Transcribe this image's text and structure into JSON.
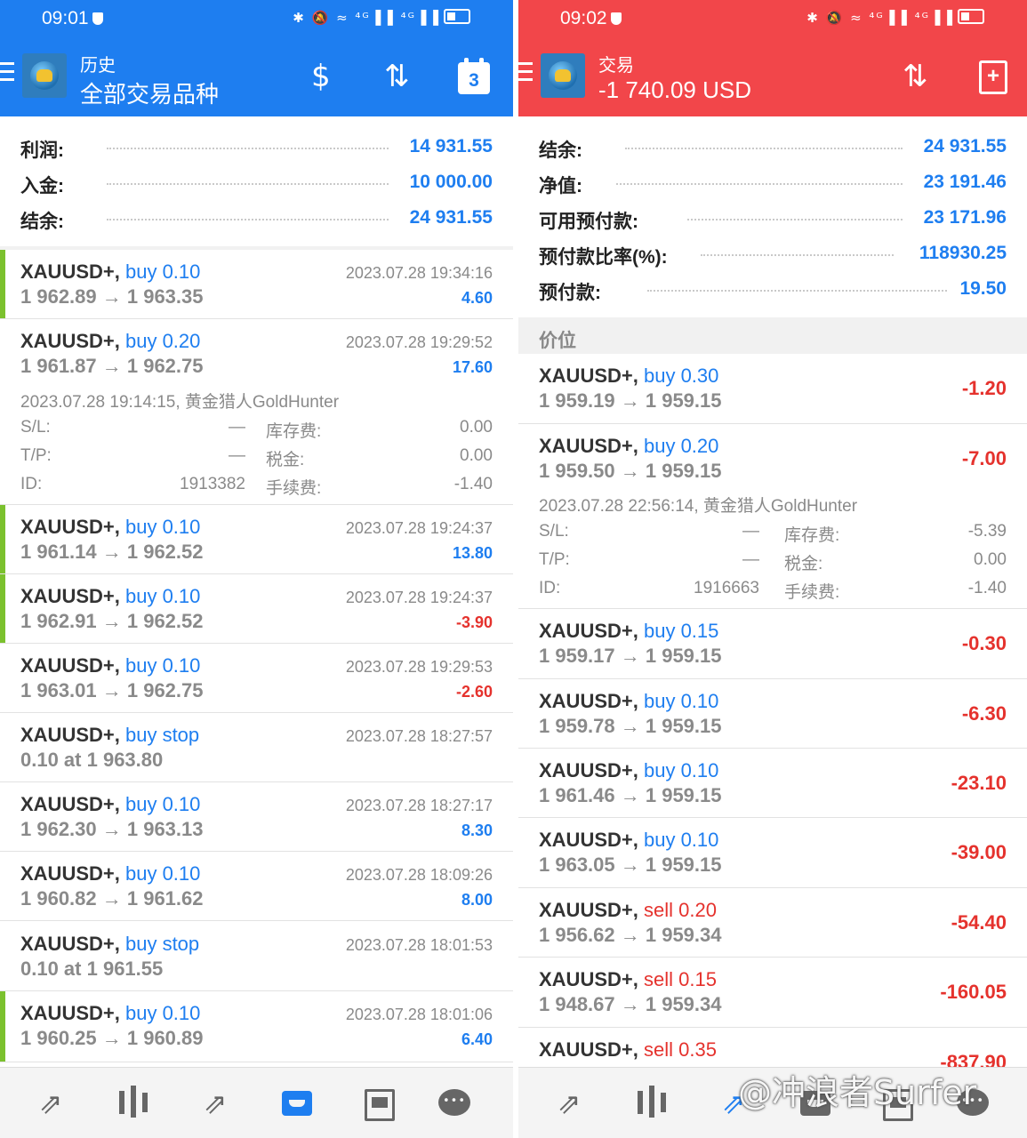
{
  "left": {
    "status": {
      "time": "09:01",
      "icons": "✱ 🔕 ≈ ⁴ᴳ▐▐ ⁴ᴳ▐▐"
    },
    "header": {
      "subtitle": "历史",
      "title": "全部交易品种",
      "icons": [
        "dollar-refresh-icon",
        "sort-icon",
        "calendar-icon"
      ],
      "calendar_day": "3"
    },
    "summary": [
      {
        "label": "利润:",
        "value": "14 931.55"
      },
      {
        "label": "入金:",
        "value": "10 000.00"
      },
      {
        "label": "结余:",
        "value": "24 931.55"
      }
    ],
    "trades": [
      {
        "symbol": "XAUUSD+,",
        "side": "buy 0.10",
        "prices": "1 962.89 → 1 963.35",
        "time": "2023.07.28 19:34:16",
        "profit": "4.60"
      },
      {
        "symbol": "XAUUSD+,",
        "side": "buy 0.20",
        "prices": "1 961.87 → 1 962.75",
        "time": "2023.07.28 19:29:52",
        "profit": "17.60"
      },
      {
        "symbol": "XAUUSD+,",
        "side": "buy 0.10",
        "prices": "1 961.14 → 1 962.52",
        "time": "2023.07.28 19:24:37",
        "profit": "13.80"
      },
      {
        "symbol": "XAUUSD+,",
        "side": "buy 0.10",
        "prices": "1 962.91 → 1 962.52",
        "time": "2023.07.28 19:24:37",
        "profit": "-3.90"
      },
      {
        "symbol": "XAUUSD+,",
        "side": "buy 0.10",
        "prices": "1 963.01 → 1 962.75",
        "time": "2023.07.28 19:29:53",
        "profit": "-2.60"
      },
      {
        "symbol": "XAUUSD+,",
        "side": "buy stop",
        "prices": "0.10 at 1 963.80",
        "time": "2023.07.28 18:27:57",
        "profit": ""
      },
      {
        "symbol": "XAUUSD+,",
        "side": "buy 0.10",
        "prices": "1 962.30 → 1 963.13",
        "time": "2023.07.28 18:27:17",
        "profit": "8.30"
      },
      {
        "symbol": "XAUUSD+,",
        "side": "buy 0.10",
        "prices": "1 960.82 → 1 961.62",
        "time": "2023.07.28 18:09:26",
        "profit": "8.00"
      },
      {
        "symbol": "XAUUSD+,",
        "side": "buy stop",
        "prices": "0.10 at 1 961.55",
        "time": "2023.07.28 18:01:53",
        "profit": ""
      },
      {
        "symbol": "XAUUSD+,",
        "side": "buy 0.10",
        "prices": "1 960.25 → 1 960.89",
        "time": "2023.07.28 18:01:06",
        "profit": "6.40"
      }
    ],
    "detail": {
      "comment": "2023.07.28 19:14:15, 黄金猎人GoldHunter",
      "sl_label": "S/L:",
      "sl_value": "—",
      "swap_label": "库存费:",
      "swap_value": "0.00",
      "tp_label": "T/P:",
      "tp_value": "—",
      "tax_label": "税金:",
      "tax_value": "0.00",
      "id_label": "ID:",
      "id_value": "1913382",
      "fee_label": "手续费:",
      "fee_value": "-1.40"
    }
  },
  "right": {
    "status": {
      "time": "09:02",
      "icons": "✱ 🔕 ≈ ⁴ᴳ▐▐ ⁴ᴳ▐▐"
    },
    "header": {
      "subtitle": "交易",
      "title": "-1 740.09 USD",
      "icons": [
        "sort-icon",
        "new-order-icon"
      ]
    },
    "summary": [
      {
        "label": "结余:",
        "value": "24 931.55"
      },
      {
        "label": "净值:",
        "value": "23 191.46"
      },
      {
        "label": "可用预付款:",
        "value": "23 171.96"
      },
      {
        "label": "预付款比率(%):",
        "value": "118930.25"
      },
      {
        "label": "预付款:",
        "value": "19.50"
      }
    ],
    "section_title": "价位",
    "positions": [
      {
        "symbol": "XAUUSD+,",
        "side": "buy 0.30",
        "prices": "1 959.19 → 1 959.15",
        "profit": "-1.20"
      },
      {
        "symbol": "XAUUSD+,",
        "side": "buy 0.20",
        "prices": "1 959.50 → 1 959.15",
        "profit": "-7.00"
      },
      {
        "symbol": "XAUUSD+,",
        "side": "buy 0.15",
        "prices": "1 959.17 → 1 959.15",
        "profit": "-0.30"
      },
      {
        "symbol": "XAUUSD+,",
        "side": "buy 0.10",
        "prices": "1 959.78 → 1 959.15",
        "profit": "-6.30"
      },
      {
        "symbol": "XAUUSD+,",
        "side": "buy 0.10",
        "prices": "1 961.46 → 1 959.15",
        "profit": "-23.10"
      },
      {
        "symbol": "XAUUSD+,",
        "side": "buy 0.10",
        "prices": "1 963.05 → 1 959.15",
        "profit": "-39.00"
      },
      {
        "symbol": "XAUUSD+,",
        "side": "sell 0.20",
        "prices": "1 956.62 → 1 959.34",
        "profit": "-54.40"
      },
      {
        "symbol": "XAUUSD+,",
        "side": "sell 0.15",
        "prices": "1 948.67 → 1 959.34",
        "profit": "-160.05"
      },
      {
        "symbol": "XAUUSD+,",
        "side": "sell 0.35",
        "prices": "",
        "profit": "-837.90"
      }
    ],
    "detail": {
      "comment": "2023.07.28 22:56:14, 黄金猎人GoldHunter",
      "sl_label": "S/L:",
      "sl_value": "—",
      "swap_label": "库存费:",
      "swap_value": "-5.39",
      "tp_label": "T/P:",
      "tp_value": "—",
      "tax_label": "税金:",
      "tax_value": "0.00",
      "id_label": "ID:",
      "id_value": "1916663",
      "fee_label": "手续费:",
      "fee_value": "-1.40"
    }
  },
  "bottom_nav": [
    "quotes-icon",
    "chart-icon",
    "trade-icon",
    "history-icon",
    "news-icon",
    "chat-icon"
  ],
  "watermark": "@冲浪者Surfer",
  "colors": {
    "blue_header": "#1e7ef0",
    "red_header": "#f2464a",
    "profit_positive": "#1e7ef0",
    "profit_negative": "#e5322d",
    "accent_bar": "#7bc12e"
  }
}
